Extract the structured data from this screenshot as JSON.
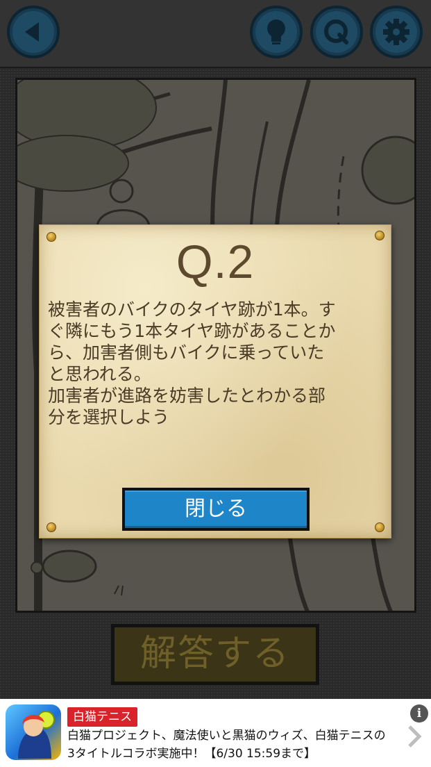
{
  "toolbar": {
    "back_icon": "back-arrow-icon",
    "hint_icon": "lightbulb-icon",
    "question_icon": "q-icon",
    "settings_icon": "gear-icon"
  },
  "modal": {
    "title": "Q.2",
    "body": "被害者のバイクのタイヤ跡が1本。す\nぐ隣にもう1本タイヤ跡があることか\nら、加害者側もバイクに乗っていた\nと思われる。\n加害者が進路を妨害したとわかる部\n分を選択しよう",
    "close_label": "閉じる"
  },
  "answer_button": {
    "label": "解答する"
  },
  "ad": {
    "badge": "白猫テニス",
    "line1": "白猫プロジェクト、魔法使いと黒猫のウィズ、白猫テニスの",
    "line2": "3タイトルコラボ実施中！【6/30 15:59まで】",
    "info": "i"
  },
  "colors": {
    "accent_blue": "#1f85c9",
    "toolbar_button": "#173a4e",
    "parchment": "#e9d9ad",
    "ad_badge": "#d9232a"
  }
}
